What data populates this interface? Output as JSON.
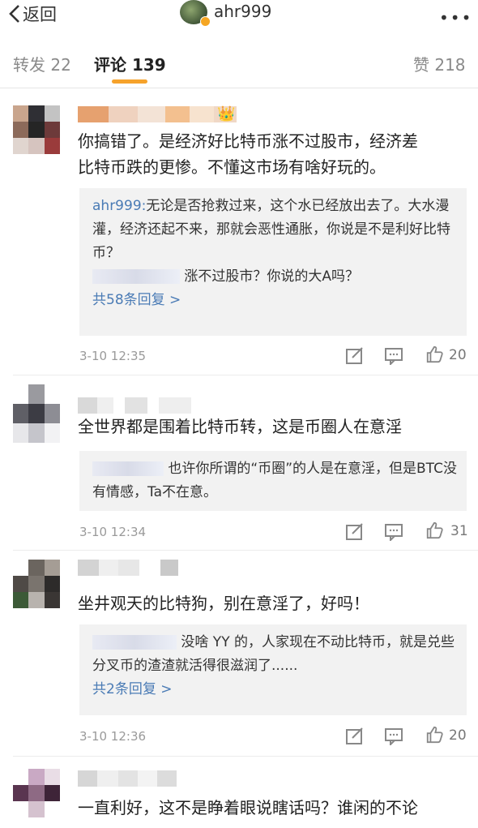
{
  "header": {
    "back_label": "返回",
    "username": "ahr999",
    "more_label": "•••"
  },
  "tabs": [
    {
      "label": "转发 22"
    },
    {
      "label": "评论 139"
    },
    {
      "label": "赞 218"
    }
  ],
  "comments": [
    {
      "text_lines": [
        "你搞错了。是经济好比特币涨不过股市，经济差",
        "比特币跌的更惨。不懂这市场有啥好玩的。"
      ],
      "replies": [
        {
          "name": "ahr999:",
          "text": "无论是否抢救过来，这个水已经放出去了。大水漫灌，经济还起不来，那就会恶性通胀，你说是不是利好比特币？"
        },
        {
          "name": "",
          "text": "涨不过股市？你说的大A吗？"
        }
      ],
      "more": "共58条回复 >",
      "time": "3-10 12:35",
      "likes": "20"
    },
    {
      "text_lines": [
        "全世界都是围着比特币转，这是币圈人在意淫"
      ],
      "replies": [
        {
          "name": "",
          "text": "也许你所谓的“币圈”的人是在意淫，但是BTC没有情感，Ta不在意。"
        }
      ],
      "more": "",
      "time": "3-10 12:34",
      "likes": "31"
    },
    {
      "text_lines": [
        "坐井观天的比特狗，别在意淫了，好吗！"
      ],
      "replies": [
        {
          "name": "",
          "text": "没啥 YY 的，人家现在不动比特币，就是兑些分叉币的渣渣就活得很滋润了......"
        }
      ],
      "more": "共2条回复 >",
      "time": "3-10 12:36",
      "likes": "20"
    },
    {
      "text_lines": [
        "一直利好，这不是睁着眼说瞎话吗？谁闲的不论"
      ],
      "time": "",
      "likes": ""
    }
  ],
  "colors": {
    "accent": "#f6a22b",
    "link": "#4a7bb5",
    "reply_bg": "#f2f2f2"
  }
}
